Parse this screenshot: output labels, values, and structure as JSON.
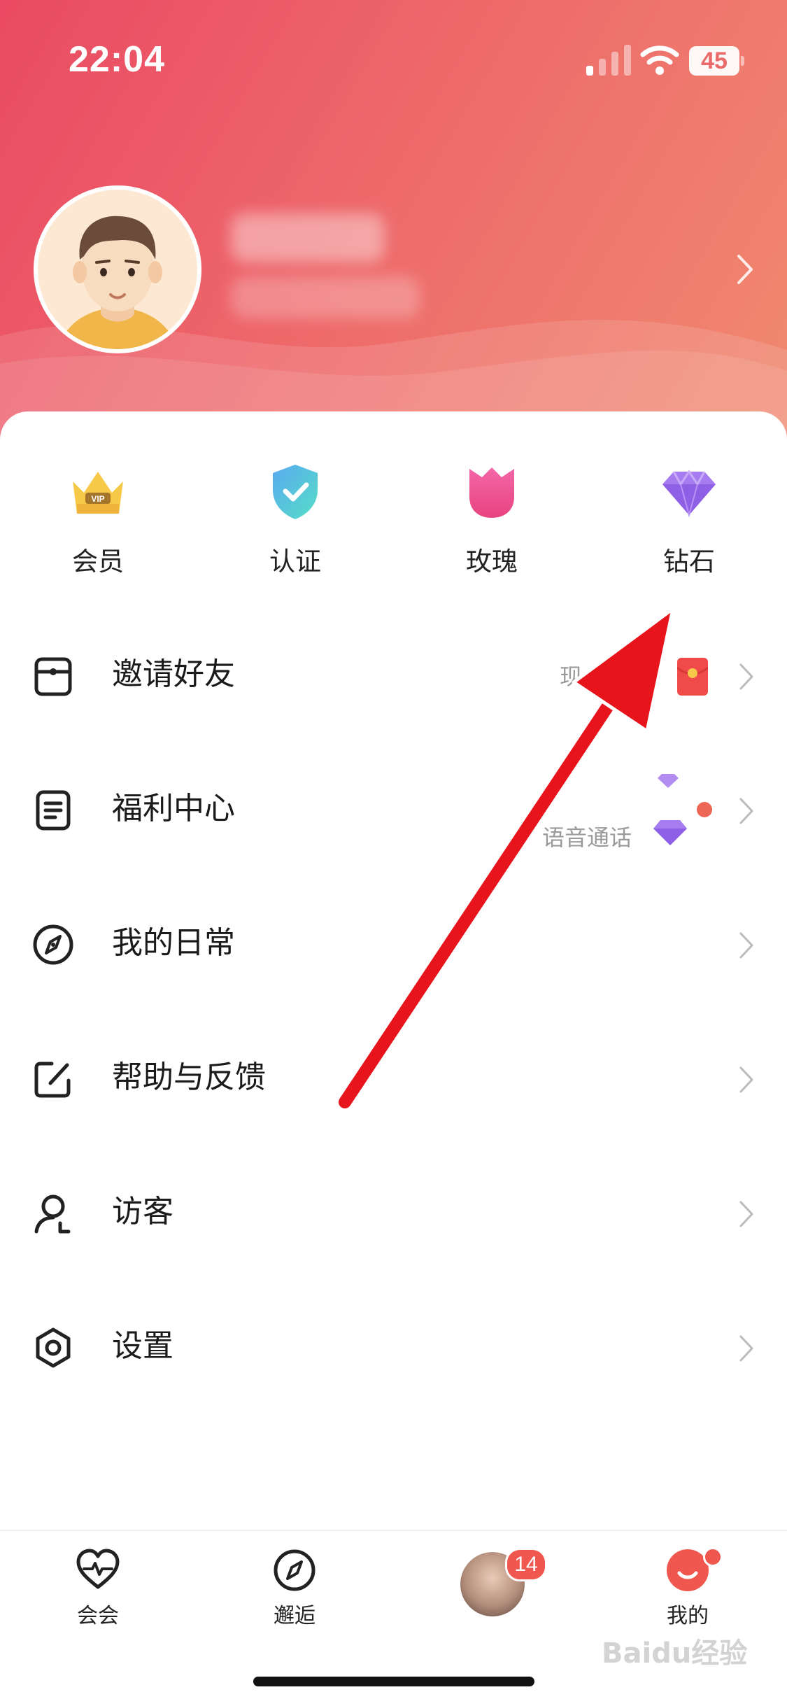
{
  "status_bar": {
    "time": "22:04",
    "battery": "45"
  },
  "quick_actions": [
    {
      "label": "会员",
      "icon": "vip-crown-icon"
    },
    {
      "label": "认证",
      "icon": "verified-shield-icon"
    },
    {
      "label": "玫瑰",
      "icon": "rose-icon"
    },
    {
      "label": "钻石",
      "icon": "diamond-icon"
    }
  ],
  "menu": [
    {
      "label": "邀请好友",
      "icon": "invite-icon",
      "extra": "现"
    },
    {
      "label": "福利中心",
      "icon": "welfare-icon",
      "extra": "语音通话"
    },
    {
      "label": "我的日常",
      "icon": "compass-icon"
    },
    {
      "label": "帮助与反馈",
      "icon": "edit-icon"
    },
    {
      "label": "访客",
      "icon": "visitor-icon"
    },
    {
      "label": "设置",
      "icon": "settings-icon"
    }
  ],
  "tabs": [
    {
      "label": "会会",
      "icon": "heart-pulse-icon"
    },
    {
      "label": "邂逅",
      "icon": "compass-icon"
    },
    {
      "label": "",
      "icon": "chat-avatar",
      "badge": "14"
    },
    {
      "label": "我的",
      "icon": "me-smile-icon"
    }
  ],
  "watermark": "Baidu经验",
  "colors": {
    "accent": "#ea4a63",
    "badge": "#f0574e",
    "arrow": "#e8141c"
  }
}
